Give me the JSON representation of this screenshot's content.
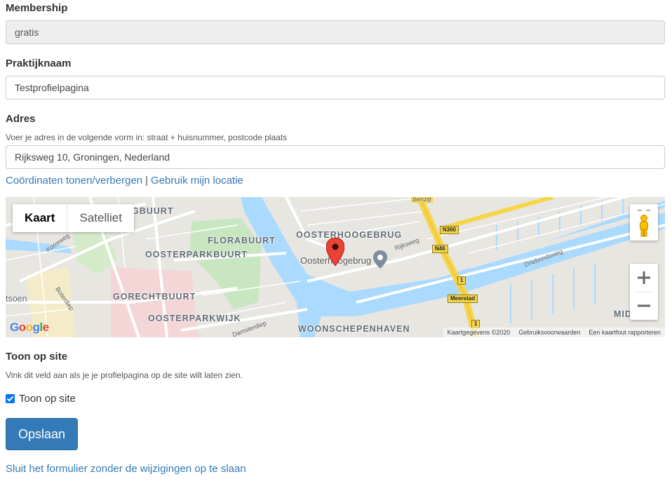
{
  "membership": {
    "label": "Membership",
    "value": "gratis"
  },
  "praktijknaam": {
    "label": "Praktijknaam",
    "value": "Testprofielpagina"
  },
  "adres": {
    "label": "Adres",
    "help": "Voer je adres in de volgende vorm in: straat + huisnummer, postcode plaats",
    "value": "Rijksweg 10, Groningen, Nederland",
    "link_coords": "Coördinaten tonen/verbergen",
    "separator": "|",
    "link_location": "Gebruik mijn locatie"
  },
  "map": {
    "type_kaart": "Kaart",
    "type_satelliet": "Satelliet",
    "zoom_in": "+",
    "zoom_out": "−",
    "marker_icon": "map-pin-icon",
    "pegman_icon": "pegman-icon",
    "google_logo": "Google",
    "attribution": {
      "data": "Kaartgegevens ©2020",
      "terms": "Gebruiksvoorwaarden",
      "report": "Een kaartfout rapporteren"
    },
    "district_labels": {
      "gbuurt": "GBUURT",
      "florabuurt": "FLORABUURT",
      "oosterparkbuurt": "OOSTERPARKBUURT",
      "oosterhoogebrug": "OOSTERHOOGEBRUG",
      "gorechtbuurt": "GORECHTBUURT",
      "oosterparkwijk": "OOSTERPARKWIJK",
      "woonschepenhaven": "WOONSCHEPENHAVEN",
      "mid": "MID",
      "tsoen": "tsoen"
    },
    "place_label": "Oosterhoogebrug",
    "street_labels": {
      "korreweg": "Korreweg",
      "boterdiep": "Boterdiep",
      "rijksweg": "Rijksweg",
      "driebondsweg": "Driebondsweg",
      "damsterdiep": "Damsterdiep",
      "benzijl": "Benzijl"
    },
    "road_shields": {
      "n360": "N360",
      "n46": "N46",
      "meerstad": "Meerstad",
      "r1a": "1",
      "r1b": "1"
    }
  },
  "toon": {
    "label": "Toon op site",
    "help": "Vink dit veld aan als je je profielpagina op de site wilt laten zien.",
    "checkbox_label": "Toon op site",
    "checked": true
  },
  "actions": {
    "save_label": "Opslaan",
    "close_label": "Sluit het formulier zonder de wijzigingen op te slaan"
  },
  "colors": {
    "link": "#337ab7",
    "button": "#337ab7",
    "checkbox": "#0075ff",
    "water": "#aadaff",
    "marker": "#ea4335"
  }
}
